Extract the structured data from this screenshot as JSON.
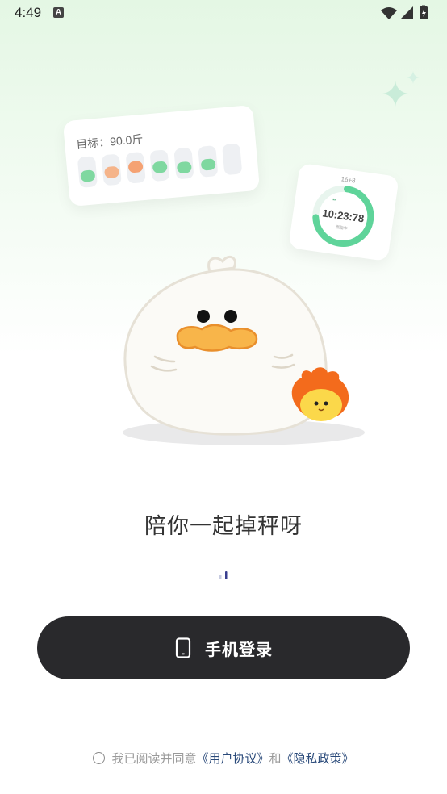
{
  "status_bar": {
    "time": "4:49",
    "notification_icon": "A"
  },
  "goal_card": {
    "title": "目标：90.0斤",
    "bars": [
      {
        "level": 0.25,
        "color": "#7fd8a0"
      },
      {
        "level": 0.35,
        "color": "#f5b48a"
      },
      {
        "level": 0.55,
        "color": "#f5a273"
      },
      {
        "level": 0.4,
        "color": "#7fd8a0"
      },
      {
        "level": 0.25,
        "color": "#7fd8a0"
      },
      {
        "level": 0.3,
        "color": "#7fd8a0"
      },
      {
        "level": 0.0,
        "color": "#eef0f3"
      }
    ]
  },
  "timer_card": {
    "mode": "16+8",
    "time": "10:23:78",
    "sublabel": "燃脂中",
    "progress": 0.72
  },
  "main": {
    "slogan": "陪你一起掉秤呀"
  },
  "login": {
    "button_label": "手机登录"
  },
  "agreement": {
    "prefix": "我已阅读并同意",
    "user_agreement": "《用户协议》",
    "conjunction": "和",
    "privacy_policy": "《隐私政策》"
  },
  "colors": {
    "accent_green": "#5fd49a",
    "button_dark": "#29292c",
    "link_blue": "#2a4a7a",
    "duck_beak": "#f8b54a",
    "fire_orange": "#f36b1c"
  }
}
